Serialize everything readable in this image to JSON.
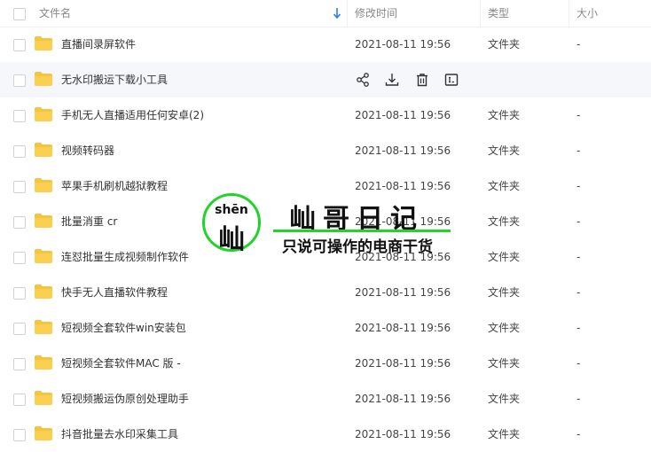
{
  "header": {
    "name": "文件名",
    "modified": "修改时间",
    "type": "类型",
    "size": "大小"
  },
  "rows": [
    {
      "name": "直播间录屏软件",
      "date": "2021-08-11 19:56",
      "type": "文件夹",
      "size": "-"
    },
    {
      "name": "无水印搬运下载小工具",
      "date": "",
      "type": "",
      "size": ""
    },
    {
      "name": "手机无人直播适用任何安卓(2)",
      "date": "2021-08-11 19:56",
      "type": "文件夹",
      "size": "-"
    },
    {
      "name": "视频转码器",
      "date": "2021-08-11 19:56",
      "type": "文件夹",
      "size": "-"
    },
    {
      "name": "苹果手机刷机越狱教程",
      "date": "2021-08-11 19:56",
      "type": "文件夹",
      "size": "-"
    },
    {
      "name": "批量消重 cr",
      "date": "2021-08-11 19:56",
      "type": "文件夹",
      "size": "-"
    },
    {
      "name": "连怼批量生成视频制作软件",
      "date": "2021-08-11 19:56",
      "type": "文件夹",
      "size": "-"
    },
    {
      "name": "快手无人直播软件教程",
      "date": "2021-08-11 19:56",
      "type": "文件夹",
      "size": "-"
    },
    {
      "name": "短视频全套软件win安装包",
      "date": "2021-08-11 19:56",
      "type": "文件夹",
      "size": "-"
    },
    {
      "name": "短视频全套软件MAC 版 -",
      "date": "2021-08-11 19:56",
      "type": "文件夹",
      "size": "-"
    },
    {
      "name": "短视频搬运伪原创处理助手",
      "date": "2021-08-11 19:56",
      "type": "文件夹",
      "size": "-"
    },
    {
      "name": "抖音批量去水印采集工具",
      "date": "2021-08-11 19:56",
      "type": "文件夹",
      "size": "-"
    }
  ],
  "hover_actions": [
    "share-icon",
    "download-icon",
    "delete-icon",
    "rename-icon"
  ],
  "watermark": {
    "pinyin": "shēn",
    "char": "屾",
    "title": "屾哥日记",
    "subtitle": "只说可操作的电商干货"
  },
  "colors": {
    "accent": "#2f7cf6",
    "folder": "#f7c441",
    "watermark_green": "#22d32a"
  }
}
